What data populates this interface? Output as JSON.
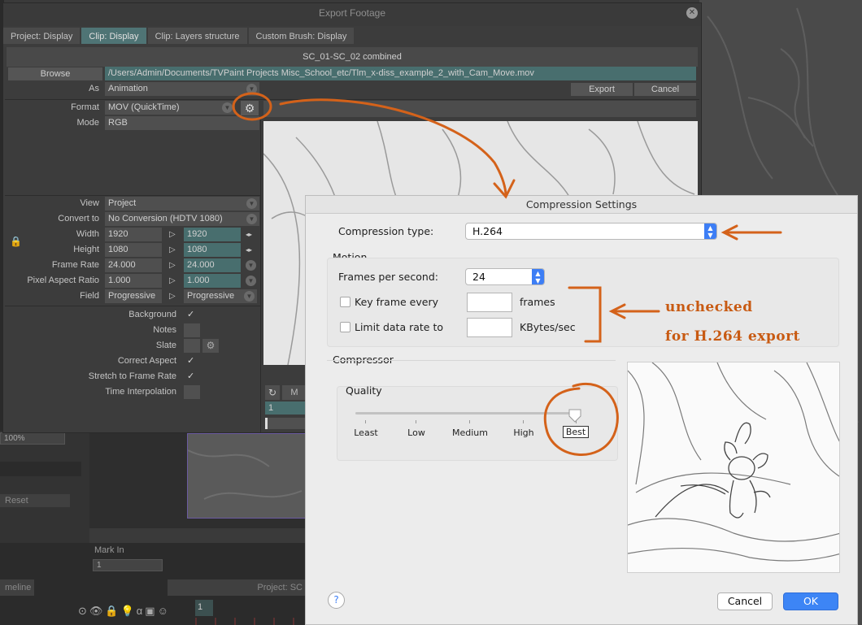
{
  "export_window": {
    "title": "Export Footage",
    "tabs": [
      "Project: Display",
      "Clip: Display",
      "Clip: Layers structure",
      "Custom Brush: Display"
    ],
    "active_tab": 1,
    "scene": "SC_01-SC_02 combined",
    "browse_label": "Browse",
    "path": "/Users/Admin/Documents/TVPaint Projects Misc_School_etc/Tlm_x-diss_example_2_with_Cam_Move.mov",
    "as_label": "As",
    "as_value": "Animation",
    "export_button": "Export",
    "cancel_button": "Cancel",
    "format_label": "Format",
    "format_value": "MOV (QuickTime)",
    "mode_label": "Mode",
    "mode_value": "RGB",
    "view_label": "View",
    "view_value": "Project",
    "convert_label": "Convert to",
    "convert_value": "No Conversion (HDTV 1080)",
    "width_label": "Width",
    "width_src": "1920",
    "width_dst": "1920",
    "height_label": "Height",
    "height_src": "1080",
    "height_dst": "1080",
    "framerate_label": "Frame Rate",
    "framerate_src": "24.000",
    "framerate_dst": "24.000",
    "par_label": "Pixel Aspect Ratio",
    "par_src": "1.000",
    "par_dst": "1.000",
    "field_label": "Field",
    "field_src": "Progressive",
    "field_dst": "Progressive",
    "background_label": "Background",
    "notes_label": "Notes",
    "slate_label": "Slate",
    "correct_aspect_label": "Correct Aspect",
    "stretch_label": "Stretch to Frame Rate",
    "time_interp_label": "Time Interpolation",
    "preview_frame": "1"
  },
  "compression_dialog": {
    "title": "Compression Settings",
    "compression_type_label": "Compression type:",
    "compression_type_value": "H.264",
    "motion_label": "Motion",
    "fps_label": "Frames per second:",
    "fps_value": "24",
    "keyframe_label": "Key frame every",
    "keyframe_unit": "frames",
    "limit_label": "Limit data rate to",
    "limit_unit": "KBytes/sec",
    "compressor_label": "Compressor",
    "quality_label": "Quality",
    "quality_ticks": [
      "Least",
      "Low",
      "Medium",
      "High",
      "Best"
    ],
    "quality_level": 1.0,
    "help_label": "?",
    "cancel_button": "Cancel",
    "ok_button": "OK"
  },
  "annotations": {
    "line1": "unchecked",
    "line2": "for H.264 export"
  },
  "background_app": {
    "zoom": "100%",
    "reset": "Reset",
    "mark_in": "Mark In",
    "mark_in_value": "1",
    "timeline_label": "meline",
    "project_label": "Project: SC",
    "frame_number": "1",
    "preview_m": "M"
  },
  "colors": {
    "annotation_orange": "#d4621a",
    "mac_blue": "#3d7ef5",
    "teal_field": "#486e6e"
  }
}
